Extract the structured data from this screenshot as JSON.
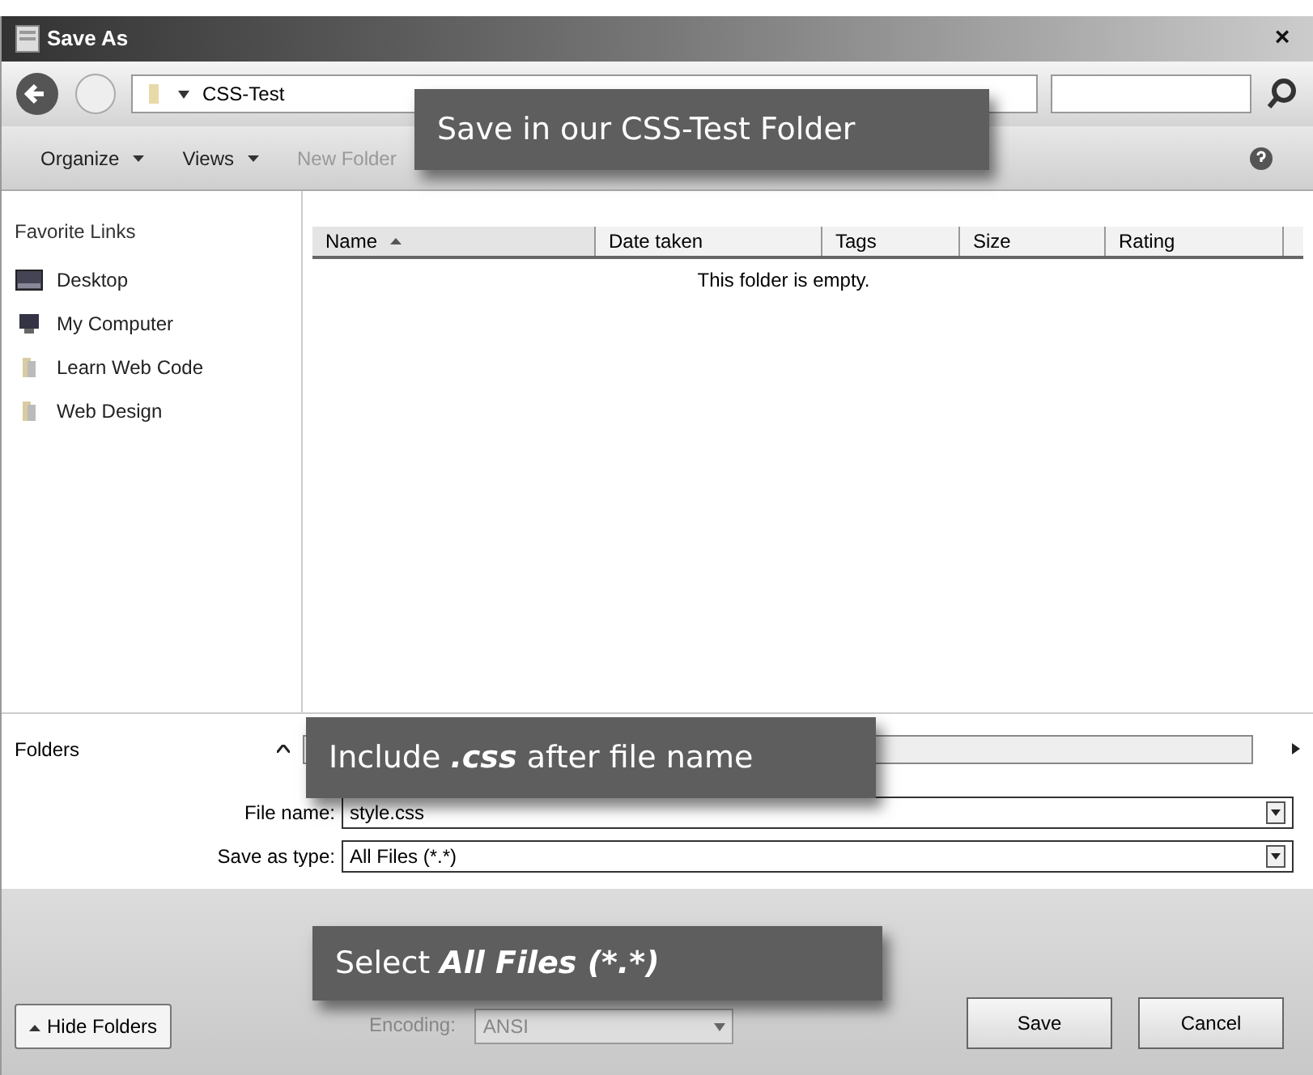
{
  "window": {
    "title": "Save As",
    "close": "×"
  },
  "address_bar": {
    "path": "CSS-Test"
  },
  "toolbar": [
    {
      "label": "Organize",
      "kind": "menu",
      "disabled": false
    },
    {
      "label": "Views",
      "kind": "menu",
      "disabled": false
    },
    {
      "label": "New Folder",
      "kind": "button",
      "disabled": true
    }
  ],
  "sidebar": {
    "heading": "Favorite Links",
    "items": [
      {
        "label": "Desktop",
        "kind": "desktop"
      },
      {
        "label": "My Computer",
        "kind": "computer"
      },
      {
        "label": "Learn Web Code",
        "kind": "folder"
      },
      {
        "label": "Web Design",
        "kind": "folder"
      }
    ],
    "folders_toggle": "Folders"
  },
  "file_list": {
    "columns": [
      {
        "label": "Name",
        "sorted": true
      },
      {
        "label": "Date taken",
        "sorted": false
      },
      {
        "label": "Tags",
        "sorted": false
      },
      {
        "label": "Size",
        "sorted": false
      },
      {
        "label": "Rating",
        "sorted": false
      }
    ],
    "empty_message": "This folder is empty."
  },
  "form": [
    {
      "label": "File name:",
      "value": "style.css"
    },
    {
      "label": "Save as type:",
      "value": "All Files  (*.*)"
    }
  ],
  "footer": {
    "hide_folders": "Hide Folders",
    "encoding_label": "Encoding:",
    "encoding_value": "ANSI",
    "buttons": [
      "Save",
      "Cancel"
    ]
  },
  "callouts": [
    {
      "kind": "address",
      "parts": [
        {
          "text": "Save in our CSS-Test Folder",
          "emphasis": false
        }
      ]
    },
    {
      "kind": "filename",
      "parts": [
        {
          "text": "Include ",
          "emphasis": false
        },
        {
          "text": ".css",
          "emphasis": true
        },
        {
          "text": " after file name",
          "emphasis": false
        }
      ]
    },
    {
      "kind": "type",
      "parts": [
        {
          "text": "Select ",
          "emphasis": false
        },
        {
          "text": "All Files (*.*)",
          "emphasis": true
        }
      ]
    }
  ]
}
